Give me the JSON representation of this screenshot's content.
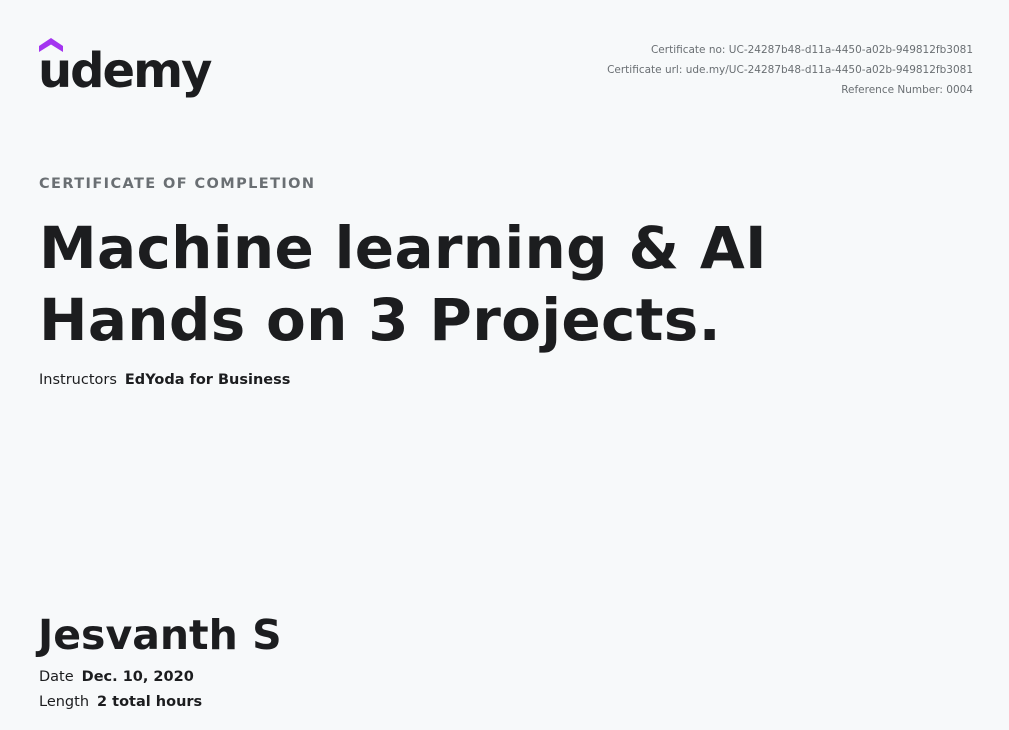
{
  "brand": {
    "logo_text": "udemy",
    "accent_color": "#a435f0"
  },
  "certificate": {
    "certificate_no": "Certificate no: UC-24287b48-d11a-4450-a02b-949812fb3081",
    "certificate_url": "Certificate url: ude.my/UC-24287b48-d11a-4450-a02b-949812fb3081",
    "reference_number": "Reference Number: 0004",
    "eyebrow": "CERTIFICATE OF COMPLETION",
    "course_title_line1": "Machine learning & AI",
    "course_title_line2": "Hands on 3 Projects.",
    "instructors_label": "Instructors",
    "instructors_value": "EdYoda for Business",
    "recipient_name": "Jesvanth S",
    "date_label": "Date",
    "date_value": "Dec. 10, 2020",
    "length_label": "Length",
    "length_value": "2 total hours"
  }
}
